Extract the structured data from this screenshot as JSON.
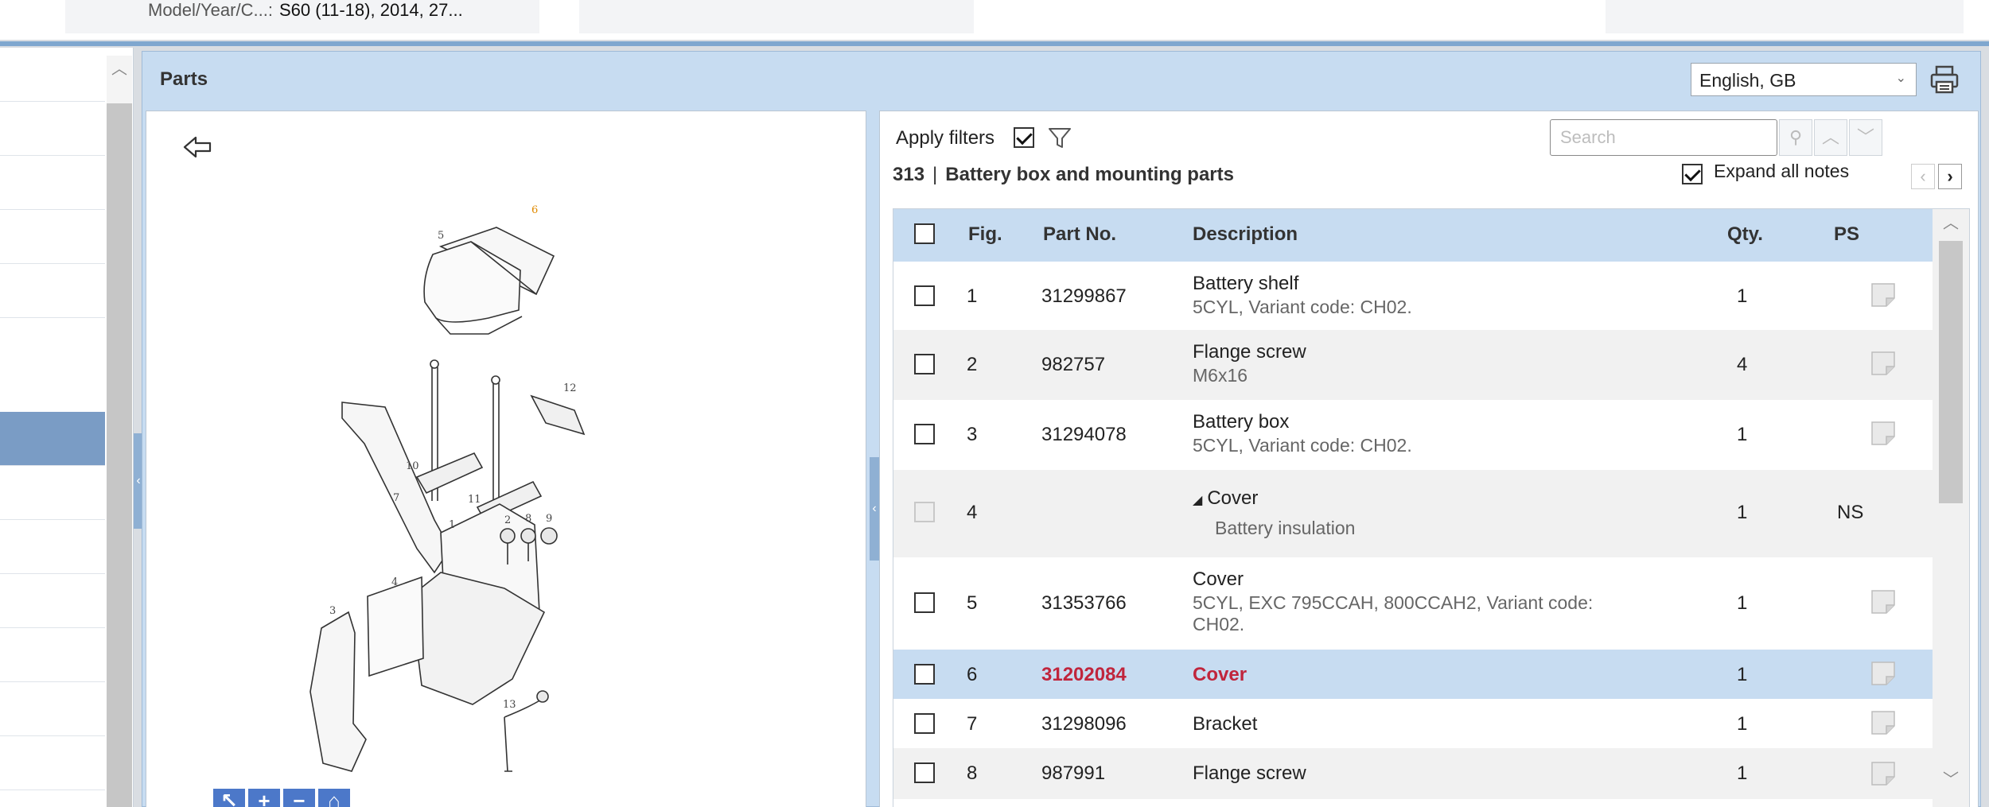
{
  "header": {
    "model_label": "Model/Year/C...:",
    "model_value": "S60 (11-18), 2014, 27..."
  },
  "panel": {
    "title": "Parts",
    "language": "English, GB"
  },
  "filters": {
    "apply_label": "Apply filters",
    "apply_checked": true,
    "search_placeholder": "Search",
    "expand_label": "Expand all notes",
    "expand_checked": true
  },
  "section": {
    "number": "313",
    "separator": "|",
    "name": "Battery box and mounting parts"
  },
  "table": {
    "headers": {
      "fig": "Fig.",
      "part_no": "Part No.",
      "description": "Description",
      "qty": "Qty.",
      "ps": "PS"
    },
    "rows": [
      {
        "fig": "1",
        "part_no": "31299867",
        "description": "Battery shelf",
        "note": "5CYL, Variant code: CH02.",
        "qty": "1",
        "ps": ""
      },
      {
        "fig": "2",
        "part_no": "982757",
        "description": "Flange screw",
        "note": "M6x16",
        "qty": "4",
        "ps": ""
      },
      {
        "fig": "3",
        "part_no": "31294078",
        "description": "Battery box",
        "note": "5CYL, Variant code: CH02.",
        "qty": "1",
        "ps": ""
      },
      {
        "fig": "4",
        "part_no": "",
        "description": "Cover",
        "note": "Battery insulation",
        "qty": "1",
        "ps": "NS"
      },
      {
        "fig": "5",
        "part_no": "31353766",
        "description": "Cover",
        "note": "5CYL, EXC 795CCAH, 800CCAH2, Variant code: CH02.",
        "qty": "1",
        "ps": ""
      },
      {
        "fig": "6",
        "part_no": "31202084",
        "description": "Cover",
        "note": "",
        "qty": "1",
        "ps": ""
      },
      {
        "fig": "7",
        "part_no": "31298096",
        "description": "Bracket",
        "note": "",
        "qty": "1",
        "ps": ""
      },
      {
        "fig": "8",
        "part_no": "987991",
        "description": "Flange screw",
        "note": "",
        "qty": "1",
        "ps": ""
      }
    ]
  },
  "diagram": {
    "callouts": [
      "5",
      "6",
      "10",
      "12",
      "7",
      "11",
      "1",
      "2",
      "8",
      "9",
      "4",
      "3",
      "13"
    ]
  },
  "icons": {
    "print": "printer-icon",
    "filter": "funnel-icon",
    "back": "back-arrow-icon",
    "note": "note-icon"
  },
  "colors": {
    "accent": "#c7dcf1",
    "selected_text": "#c0253c",
    "nav_active": "#7a9cc5"
  }
}
